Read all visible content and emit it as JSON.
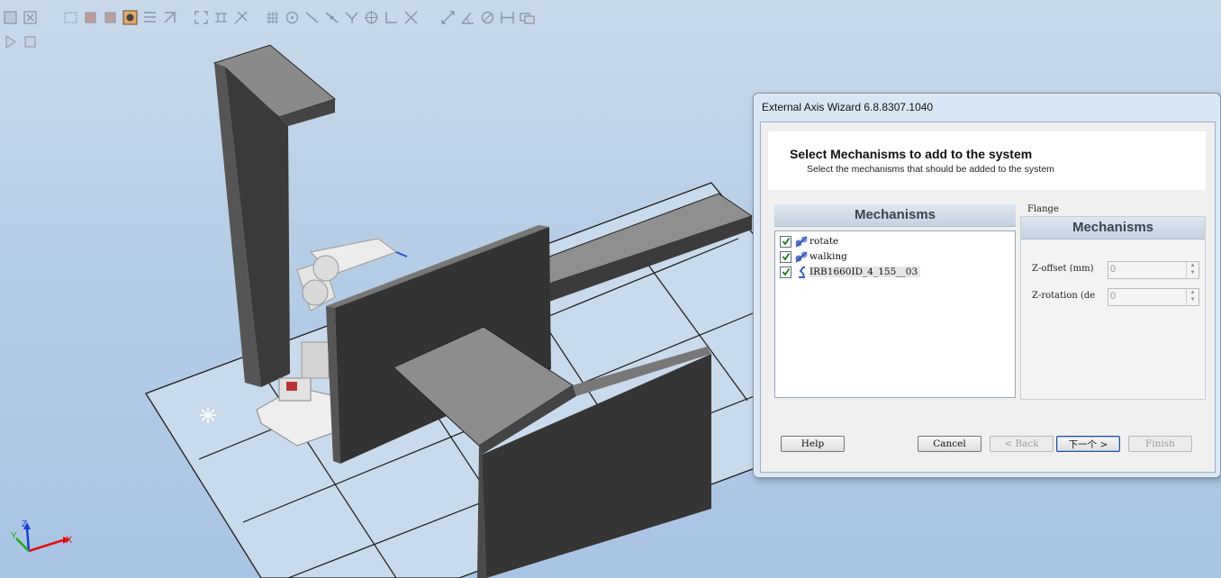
{
  "dialog": {
    "title": "External Axis Wizard 6.8.8307.1040",
    "header_title": "Select Mechanisms to add to the system",
    "header_subtitle": "Select the mechanisms that should be added to the system",
    "mechanisms_heading": "Mechanisms",
    "mechanisms": [
      {
        "label": "rotate",
        "checked": true,
        "icon": "mechanism-icon"
      },
      {
        "label": "walking",
        "checked": true,
        "icon": "mechanism-icon"
      },
      {
        "label": "IRB1660ID_4_155__03",
        "checked": true,
        "icon": "robot-icon"
      }
    ],
    "flange_label": "Flange",
    "flange_heading": "Mechanisms",
    "z_offset_label": "Z-offset (mm)",
    "z_offset_value": "0",
    "z_rotation_label": "Z-rotation (de",
    "z_rotation_value": "0",
    "buttons": {
      "help": "Help",
      "cancel": "Cancel",
      "back": "< Back",
      "next": "下一个 >",
      "finish": "Finish"
    }
  },
  "viewport": {
    "axis_x": "X",
    "axis_y": "Y",
    "axis_z": "Z"
  },
  "colors": {
    "background": "#b6cde6",
    "wall": "#333333",
    "floor_grid": "#c6d8ea"
  }
}
